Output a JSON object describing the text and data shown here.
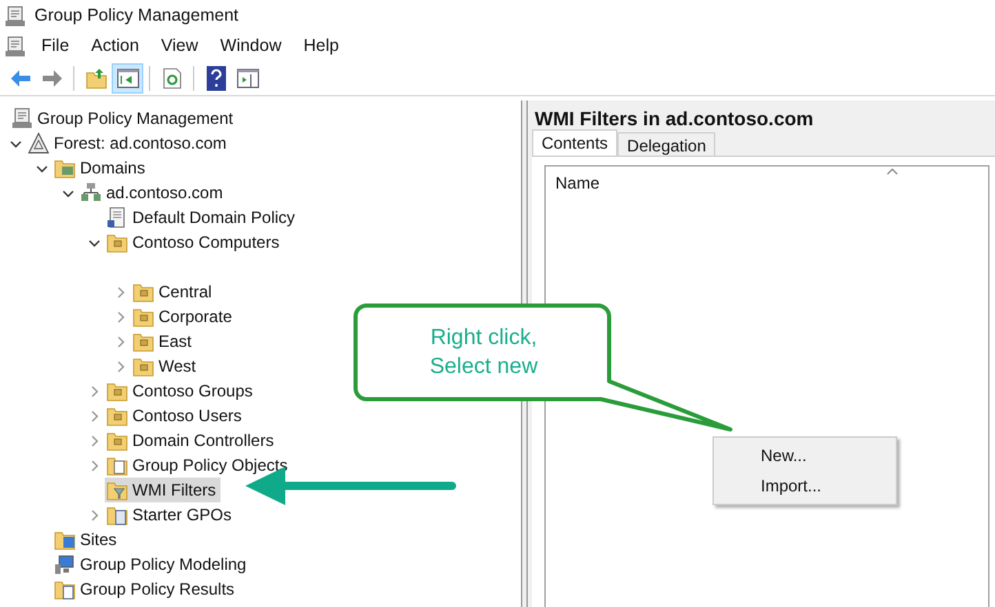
{
  "window": {
    "title": "Group Policy Management"
  },
  "menu": [
    "File",
    "Action",
    "View",
    "Window",
    "Help"
  ],
  "toolbar": [
    {
      "kind": "back",
      "selected": false
    },
    {
      "kind": "forward",
      "selected": false
    },
    {
      "kind": "up",
      "selected": false
    },
    {
      "kind": "tree",
      "selected": true
    },
    {
      "kind": "refresh",
      "selected": false
    },
    {
      "kind": "help",
      "selected": false
    },
    {
      "kind": "pane",
      "selected": false
    }
  ],
  "tree": [
    {
      "label": "Group Policy Management",
      "kind": "console",
      "selected": false,
      "children": [
        {
          "label": "Forest: ad.contoso.com",
          "kind": "forest",
          "expanded": true,
          "selected": false,
          "children": [
            {
              "label": "Domains",
              "kind": "domains",
              "expanded": true,
              "selected": false,
              "children": [
                {
                  "label": "ad.contoso.com",
                  "kind": "domain",
                  "expanded": true,
                  "selected": false,
                  "children": [
                    {
                      "label": "Default Domain Policy",
                      "kind": "gpo",
                      "selected": false
                    },
                    {
                      "label": "Contoso Computers",
                      "kind": "ou",
                      "expanded": true,
                      "selected": false,
                      "children": [
                        {
                          "label": "Central",
                          "kind": "ou",
                          "expanded": false,
                          "selected": false
                        },
                        {
                          "label": "Corporate",
                          "kind": "ou",
                          "expanded": false,
                          "selected": false
                        },
                        {
                          "label": "East",
                          "kind": "ou",
                          "expanded": false,
                          "selected": false
                        },
                        {
                          "label": "West",
                          "kind": "ou",
                          "expanded": false,
                          "selected": false
                        }
                      ]
                    },
                    {
                      "label": "Contoso Groups",
                      "kind": "ou",
                      "expanded": false,
                      "selected": false
                    },
                    {
                      "label": "Contoso Users",
                      "kind": "ou",
                      "expanded": false,
                      "selected": false
                    },
                    {
                      "label": "Domain Controllers",
                      "kind": "ou",
                      "expanded": false,
                      "selected": false
                    },
                    {
                      "label": "Group Policy Objects",
                      "kind": "gpo-folder",
                      "expanded": false,
                      "selected": false
                    },
                    {
                      "label": "WMI Filters",
                      "kind": "wmi-folder",
                      "selected": true
                    },
                    {
                      "label": "Starter GPOs",
                      "kind": "starter-folder",
                      "expanded": false,
                      "selected": false
                    }
                  ]
                }
              ]
            },
            {
              "label": "Sites",
              "kind": "sites",
              "selected": false
            },
            {
              "label": "Group Policy Modeling",
              "kind": "modeling",
              "selected": false
            },
            {
              "label": "Group Policy Results",
              "kind": "results",
              "selected": false
            }
          ]
        }
      ]
    }
  ],
  "details": {
    "title": "WMI Filters in ad.contoso.com",
    "tabs": [
      {
        "label": "Contents",
        "selected": true
      },
      {
        "label": "Delegation",
        "selected": false
      }
    ],
    "columns": [
      "Name"
    ]
  },
  "callout": {
    "lines": [
      "Right click,",
      "Select new"
    ]
  },
  "context_menu": [
    "New...",
    "Import..."
  ]
}
